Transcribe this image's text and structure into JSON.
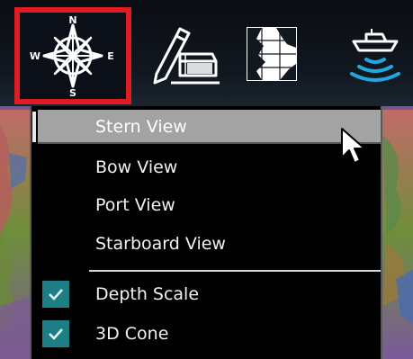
{
  "toolbar": {
    "tools": [
      {
        "icon": "compass-rose-icon",
        "selected": true,
        "letters": {
          "n": "N",
          "e": "E",
          "s": "S",
          "w": "W"
        }
      },
      {
        "icon": "route-edit-icon"
      },
      {
        "icon": "chart-map-icon"
      },
      {
        "icon": "boat-sonar-icon"
      }
    ],
    "selected_border_color": "#e11b22"
  },
  "menu": {
    "view_items": [
      {
        "label": "Stern View",
        "highlighted": true
      },
      {
        "label": "Bow View"
      },
      {
        "label": "Port View"
      },
      {
        "label": "Starboard View"
      }
    ],
    "toggle_items": [
      {
        "label": "Depth Scale",
        "checked": true
      },
      {
        "label": "3D Cone",
        "checked": true
      }
    ],
    "highlight_color": "#a3a3a3",
    "check_color": "#1d7f85"
  }
}
